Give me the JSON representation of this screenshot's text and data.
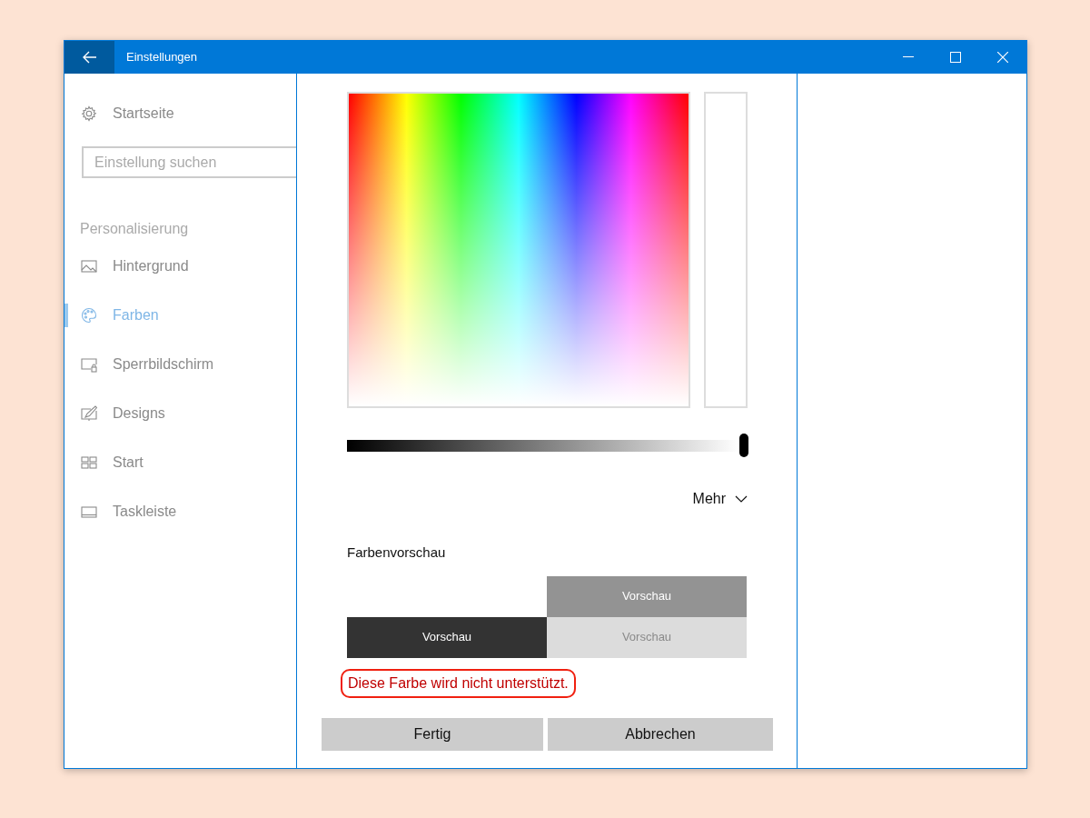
{
  "window": {
    "title": "Einstellungen"
  },
  "sidebar": {
    "home": "Startseite",
    "search": {
      "placeholder": "Einstellung suchen"
    },
    "section": "Personalisierung",
    "items": [
      {
        "label": "Hintergrund",
        "selected": false
      },
      {
        "label": "Farben",
        "selected": true
      },
      {
        "label": "Sperrbildschirm",
        "selected": false
      },
      {
        "label": "Designs",
        "selected": false
      },
      {
        "label": "Start",
        "selected": false
      },
      {
        "label": "Taskleiste",
        "selected": false
      }
    ]
  },
  "dialog": {
    "brightness": {
      "level": 1.0
    },
    "more": "Mehr",
    "preview_title": "Farbenvorschau",
    "swatches": [
      {
        "label": "Vorschau",
        "color": "#939393"
      },
      {
        "label": "Vorschau",
        "color": "#333333"
      },
      {
        "label": "Vorschau",
        "color": "#dcdcdc"
      }
    ],
    "message": {
      "text": "Diese Farbe wird nicht unterstützt.",
      "circled": true
    },
    "buttons": [
      "Fertig",
      "Abbrechen"
    ]
  }
}
